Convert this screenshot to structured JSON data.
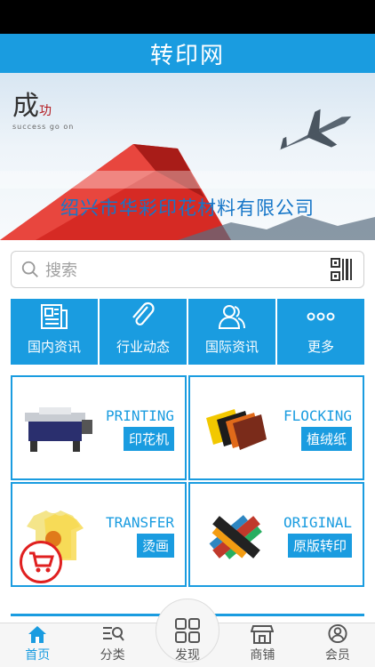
{
  "header": {
    "title": "转印网"
  },
  "banner": {
    "logo_big": "成",
    "logo_small": "功",
    "logo_sub": "success go on",
    "company": "绍兴市华彩印花材料有限公司"
  },
  "search": {
    "placeholder": "搜索"
  },
  "categories": [
    {
      "label": "国内资讯",
      "icon": "newspaper-icon"
    },
    {
      "label": "行业动态",
      "icon": "paperclip-icon"
    },
    {
      "label": "国际资讯",
      "icon": "users-icon"
    },
    {
      "label": "更多",
      "icon": "more-dots-icon"
    }
  ],
  "products": [
    {
      "en": "PRINTING",
      "zh": "印花机",
      "icon": "printer-machine-icon"
    },
    {
      "en": "FLOCKING",
      "zh": "植绒纸",
      "icon": "flock-paper-icon"
    },
    {
      "en": "TRANSFER",
      "zh": "烫画",
      "icon": "tshirt-icon"
    },
    {
      "en": "ORIGINAL",
      "zh": "原版转印",
      "icon": "typography-art-icon"
    }
  ],
  "tabs": [
    {
      "label": "首页",
      "icon": "home-icon",
      "active": true
    },
    {
      "label": "分类",
      "icon": "category-search-icon",
      "active": false
    },
    {
      "label": "发现",
      "icon": "grid-icon",
      "active": false
    },
    {
      "label": "商铺",
      "icon": "shop-icon",
      "active": false
    },
    {
      "label": "会员",
      "icon": "user-icon",
      "active": false
    }
  ],
  "colors": {
    "primary": "#1a9ce0",
    "cart": "#e02020"
  }
}
